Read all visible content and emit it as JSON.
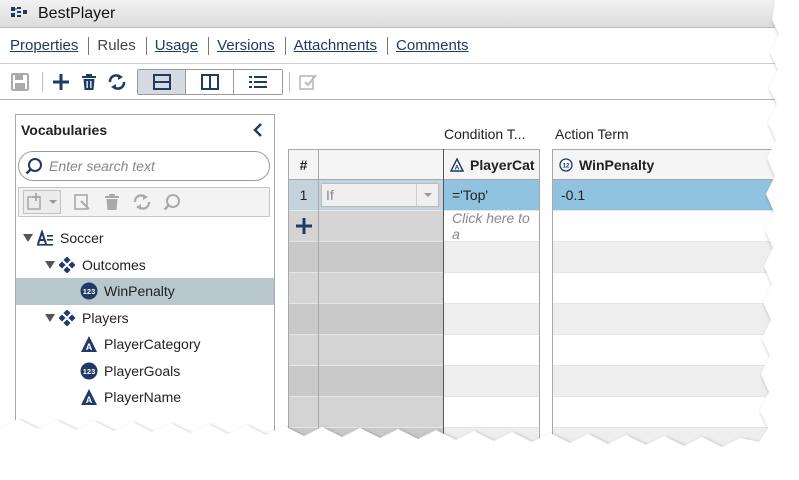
{
  "window": {
    "title": "BestPlayer"
  },
  "nav": {
    "items": [
      {
        "label": "Properties",
        "active": false
      },
      {
        "label": "Rules",
        "active": true
      },
      {
        "label": "Usage",
        "active": false
      },
      {
        "label": "Versions",
        "active": false
      },
      {
        "label": "Attachments",
        "active": false
      },
      {
        "label": "Comments",
        "active": false
      }
    ]
  },
  "toolbar": {
    "icons": [
      "save-icon",
      "add-icon",
      "delete-icon",
      "refresh-icon",
      "horizontal-layout-icon",
      "vertical-layout-icon",
      "list-view-icon",
      "validate-icon"
    ],
    "active_view": "horizontal-layout"
  },
  "vocabularies": {
    "title": "Vocabularies",
    "search_placeholder": "Enter search text",
    "tree": [
      {
        "label": "Soccer",
        "icon": "vocabulary-icon",
        "level": 0,
        "expanded": true
      },
      {
        "label": "Outcomes",
        "icon": "entity-icon",
        "level": 1,
        "expanded": true
      },
      {
        "label": "WinPenalty",
        "icon": "numeric-icon",
        "level": 2,
        "selected": true
      },
      {
        "label": "Players",
        "icon": "entity-icon",
        "level": 1,
        "expanded": true
      },
      {
        "label": "PlayerCategory",
        "icon": "character-icon",
        "level": 2
      },
      {
        "label": "PlayerGoals",
        "icon": "numeric-icon",
        "level": 2
      },
      {
        "label": "PlayerName",
        "icon": "character-icon",
        "level": 2
      }
    ]
  },
  "grid": {
    "group_headers": {
      "condition": "Condition T...",
      "action": "Action Term"
    },
    "columns": {
      "number": "#",
      "condition_term": "PlayerCat",
      "action_term": "WinPenalty"
    },
    "rows": [
      {
        "number": "1",
        "operator": "If",
        "condition": "='Top'",
        "action": "-0.1"
      }
    ],
    "new_row_placeholder": "Click here to a"
  },
  "colors": {
    "selected_row": "#8fc3e0",
    "selected_tree": "#b8c6ce",
    "link": "#1f3a64",
    "icon_blue": "#1f3a64"
  }
}
